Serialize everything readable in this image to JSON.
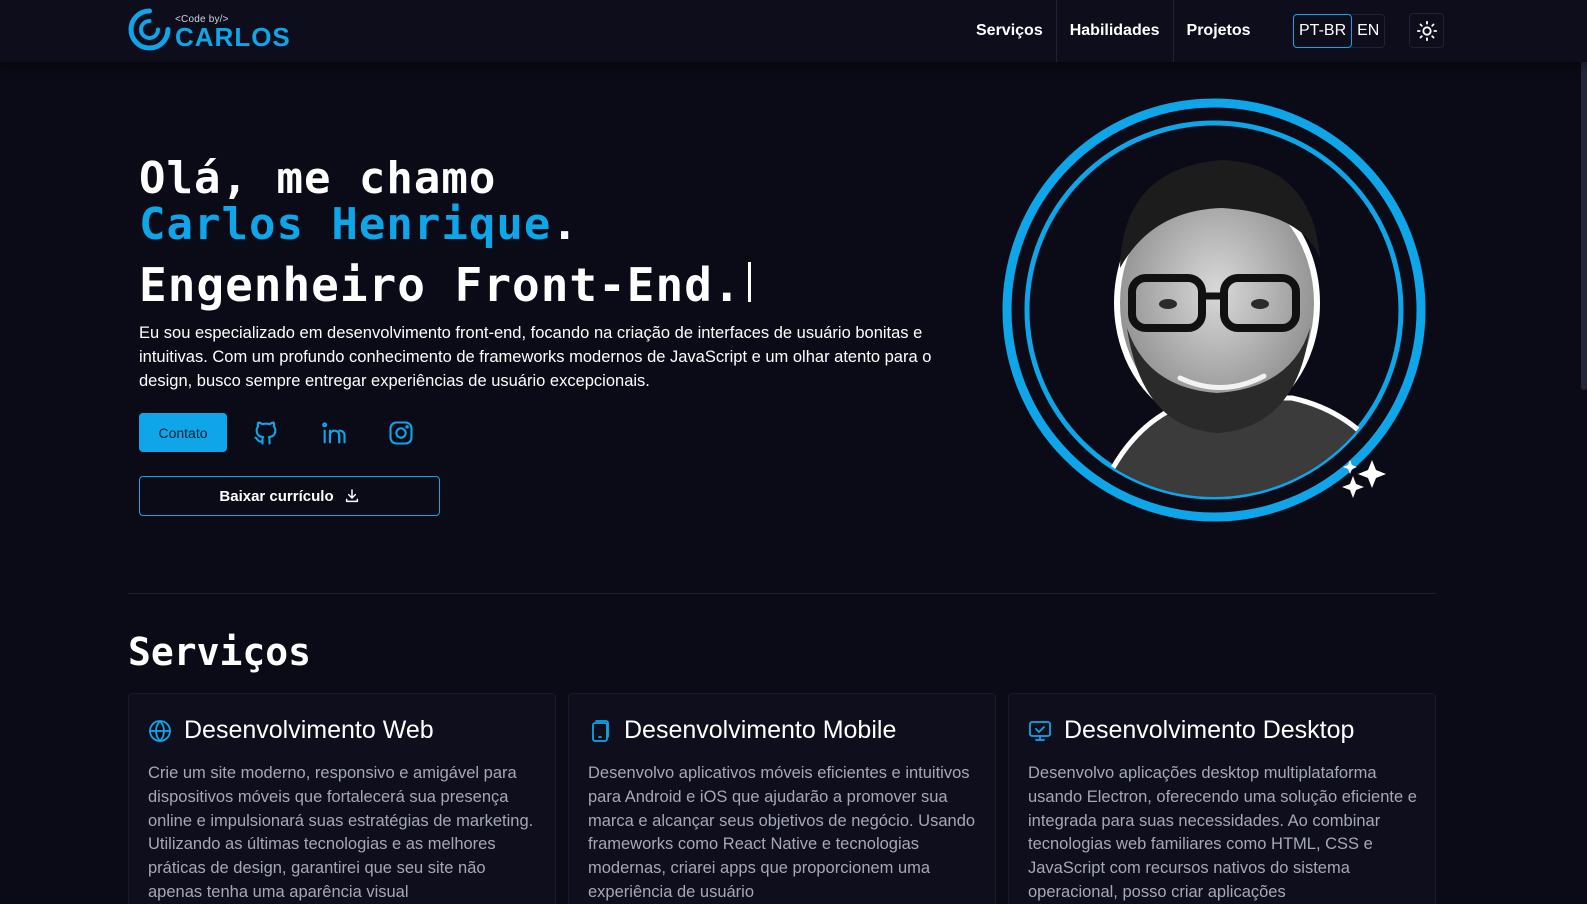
{
  "header": {
    "logo": {
      "small": "<Code by/>",
      "big": "CARLOS"
    },
    "nav": [
      {
        "label": "Serviços"
      },
      {
        "label": "Habilidades"
      },
      {
        "label": "Projetos"
      }
    ],
    "languages": [
      {
        "label": "PT-BR",
        "active": true
      },
      {
        "label": "EN",
        "active": false
      }
    ],
    "theme_icon": "sun-icon"
  },
  "hero": {
    "greeting": "Olá, me chamo",
    "name": "Carlos Henrique",
    "name_suffix": ".",
    "role": "Engenheiro Front-End.",
    "description": "Eu sou especializado em desenvolvimento front-end, focando na criação de interfaces de usuário bonitas e intuitivas. Com um profundo conhecimento de frameworks modernos de JavaScript e um olhar atento para o design, busco sempre entregar experiências de usuário excepcionais.",
    "contact_label": "Contato",
    "social": [
      {
        "icon": "github-icon"
      },
      {
        "icon": "linkedin-icon"
      },
      {
        "icon": "instagram-icon"
      }
    ],
    "cv_label": "Baixar currículo",
    "cv_icon": "download-icon"
  },
  "services": {
    "title": "Serviços",
    "cards": [
      {
        "icon": "globe-icon",
        "title": "Desenvolvimento Web",
        "text": "Crie um site moderno, responsivo e amigável para dispositivos móveis que fortalecerá sua presença online e impulsionará suas estratégias de marketing. Utilizando as últimas tecnologias e as melhores práticas de design, garantirei que seu site não apenas tenha uma aparência visual"
      },
      {
        "icon": "mobile-icon",
        "title": "Desenvolvimento Mobile",
        "text": "Desenvolvo aplicativos móveis eficientes e intuitivos para Android e iOS que ajudarão a promover sua marca e alcançar seus objetivos de negócio. Usando frameworks como React Native e tecnologias modernas, criarei apps que proporcionem uma experiência de usuário"
      },
      {
        "icon": "monitor-icon",
        "title": "Desenvolvimento Desktop",
        "text": "Desenvolvo aplicações desktop multiplataforma usando Electron, oferecendo uma solução eficiente e integrada para suas necessidades. Ao combinar tecnologias web familiares como HTML, CSS e JavaScript com recursos nativos do sistema operacional, posso criar aplicações"
      }
    ]
  },
  "colors": {
    "accent": "#0ea5e9",
    "background": "#0b0b17",
    "card": "#0e0e1c",
    "muted_text": "#a5a8b8"
  }
}
